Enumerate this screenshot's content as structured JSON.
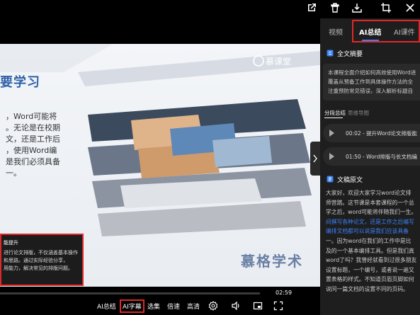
{
  "player": {
    "duration": "02:59",
    "progress_fraction": 0.0
  },
  "slide": {
    "title_fragment": "要学习",
    "body_lines": [
      "，Word可能将",
      "。无论是在校期",
      "文，还是工作后",
      "，使用Word编",
      "是我们必须具备",
      "一。"
    ],
    "logo_text": "慕课堂",
    "brand_text": "慕格学术"
  },
  "note_overlay": {
    "title": "能提升",
    "lines": [
      "进行论文排版，不仅涵盖基本操作",
      "和思路。通过实际经验分享，",
      "用能力，解决常见的排版问题。"
    ]
  },
  "controls": {
    "ai_summary": "AI总结",
    "ai_subtitle": "AI字幕",
    "episodes": "选集",
    "speed": "倍速",
    "quality": "高清"
  },
  "panel": {
    "tabs": [
      "视频",
      "AI总结",
      "AI课件"
    ],
    "active_tab": 1,
    "abstract_header": "全文摘要",
    "abstract_lines": [
      "本课程全面介绍如何高效使用Word进",
      "覆盖从预备工作到具体操作方法的全",
      "注重预防常见错误，深入解析标题自"
    ],
    "subtabs": [
      "分段总结",
      "思维导图"
    ],
    "chapters": [
      {
        "time": "00:02",
        "title": "提升Word论文排版能"
      },
      {
        "time": "01:50",
        "title": "Word排版与长文档编"
      }
    ],
    "transcript_header": "文稿原文",
    "transcript_lines": [
      {
        "text": "大家好，欢迎大家学习word论文排",
        "highlight": false
      },
      {
        "text": "师营踏。这节课是本套课程的一个总",
        "highlight": false
      },
      {
        "text": "学之后，word可能将伴随我们一生。",
        "highlight": false
      },
      {
        "text": "间撰写各种论文，还是工作之后编写",
        "highlight": true
      },
      {
        "text": "编排文档都可以说是我们应该具备",
        "highlight": true
      },
      {
        "text": "一。因为word在我们的工作中是比",
        "highlight": false
      },
      {
        "text": "及的一个基本编排工具。但是我们真",
        "highlight": false
      },
      {
        "text": "word了吗？我曾经就看到过很多朋友",
        "highlight": false
      },
      {
        "text": "设置标题，一个编号，或者说一遍又",
        "highlight": false
      },
      {
        "text": "置表格的样式。不知道页眉页脚如何",
        "highlight": false
      },
      {
        "text": "说同一篇文档的设置不同的页码。",
        "highlight": false
      }
    ]
  },
  "colors": {
    "accent_blue": "#3b82f6",
    "highlight_red": "#e02828",
    "panel_bg": "#1e1e1f",
    "slide_title": "#2f62a8"
  }
}
